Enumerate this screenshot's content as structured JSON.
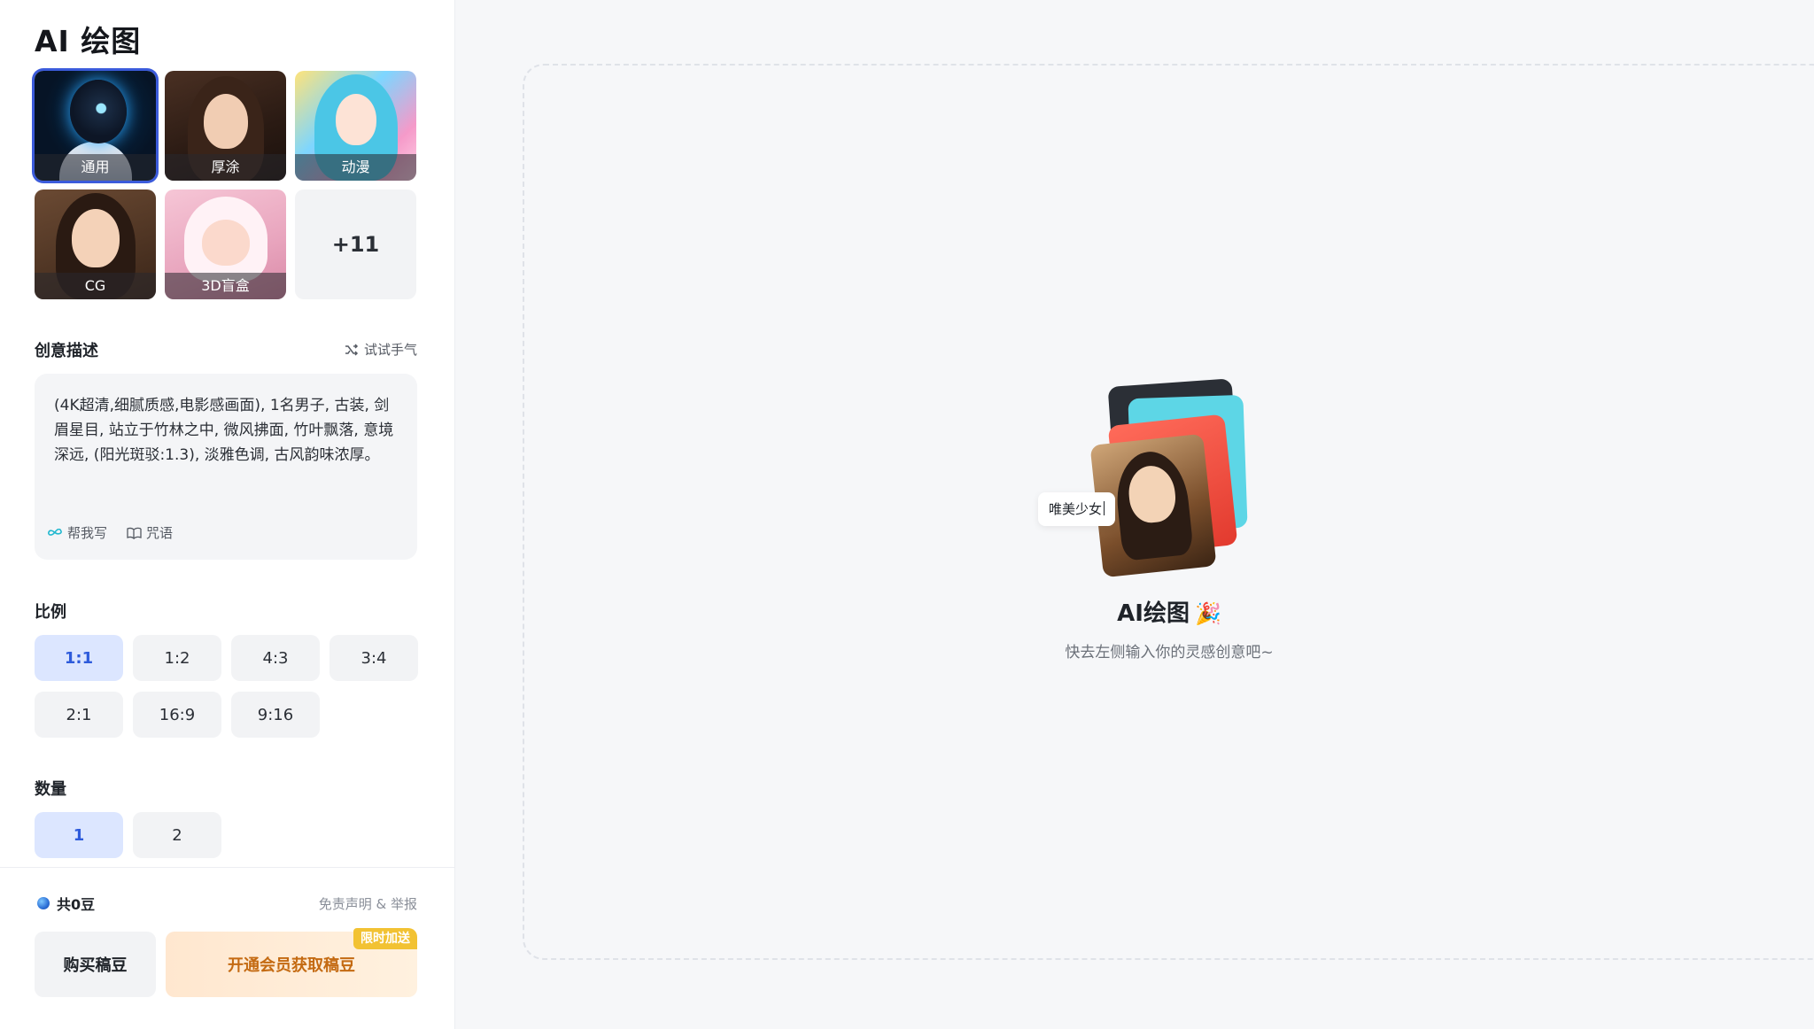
{
  "page": {
    "title": "AI 绘图"
  },
  "styles": [
    {
      "label": "通用",
      "selected": true
    },
    {
      "label": "厚涂",
      "selected": false
    },
    {
      "label": "动漫",
      "selected": false
    },
    {
      "label": "CG",
      "selected": false
    },
    {
      "label": "3D盲盒",
      "selected": false
    }
  ],
  "styles_more": "+11",
  "prompt": {
    "section_label": "创意描述",
    "try_luck": "试试手气",
    "text": "(4K超清,细腻质感,电影感画面), 1名男子, 古装, 剑眉星目, 站立于竹林之中, 微风拂面, 竹叶飘落, 意境深远, (阳光斑驳:1.3), 淡雅色调, 古风韵味浓厚。",
    "help_write": "帮我写",
    "spells": "咒语"
  },
  "ratio": {
    "section_label": "比例",
    "options": [
      "1:1",
      "1:2",
      "4:3",
      "3:4",
      "2:1",
      "16:9",
      "9:16"
    ],
    "selected": "1:1"
  },
  "quantity": {
    "section_label": "数量",
    "options": [
      "1",
      "2"
    ],
    "selected": "1"
  },
  "footer": {
    "beans": "共0豆",
    "disclaimer": "免责声明 & 举报",
    "buy": "购买稿豆",
    "vip": "开通会员获取稿豆",
    "vip_badge": "限时加送"
  },
  "empty_state": {
    "tag": "唯美少女",
    "title": "AI绘图",
    "subtitle": "快去左侧输入你的灵感创意吧~"
  },
  "colors": {
    "accent": "#2e5bdb",
    "selected_chip_bg": "#dce6ff",
    "vip_text": "#c46a12",
    "badge": "#f2c233"
  }
}
